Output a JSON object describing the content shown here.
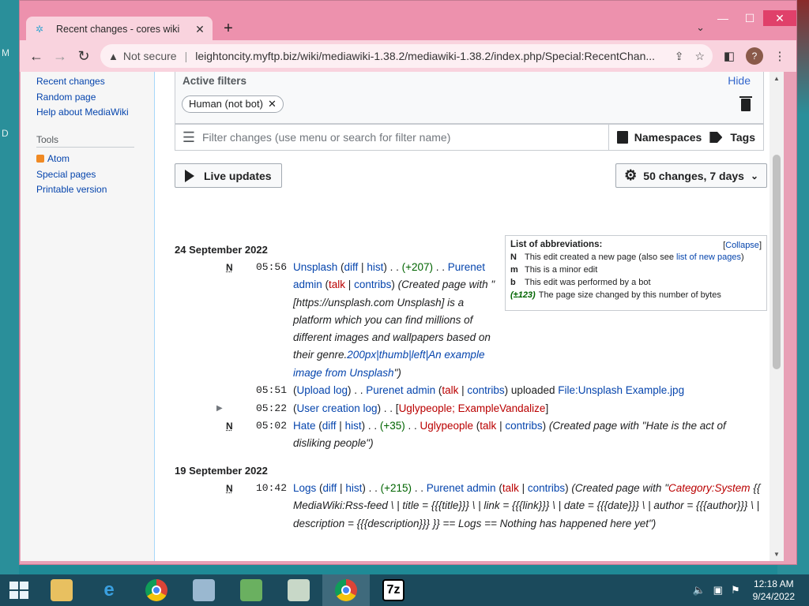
{
  "desktop": {
    "left_labels": [
      "M",
      "D"
    ]
  },
  "browser": {
    "tab_title": "Recent changes - cores wiki",
    "not_secure": "Not secure",
    "url_separator": "|",
    "url": "leightoncity.myftp.biz/wiki/mediawiki-1.38.2/mediawiki-1.38.2/index.php/Special:RecentChan...",
    "profile_initial": "?"
  },
  "sidebar": {
    "nav": [
      "Recent changes",
      "Random page",
      "Help about MediaWiki"
    ],
    "tools_heading": "Tools",
    "tools": [
      "Atom",
      "Special pages",
      "Printable version"
    ]
  },
  "filters": {
    "active_label": "Active filters",
    "hide_label": "Hide",
    "chip": "Human (not bot)",
    "search_placeholder": "Filter changes (use menu or search for filter name)",
    "namespaces": "Namespaces",
    "tags": "Tags",
    "live_updates": "Live updates",
    "limits": "50 changes, 7 days"
  },
  "legend": {
    "heading": "List of abbreviations:",
    "collapse": "Collapse",
    "rows": [
      {
        "key": "N",
        "text": "This edit created a new page (also see ",
        "link": "list of new pages",
        "after": ")"
      },
      {
        "key": "m",
        "text": "This is a minor edit"
      },
      {
        "key": "b",
        "text": "This edit was performed by a bot"
      },
      {
        "key": "(±123)",
        "text": "The page size changed by this number of bytes"
      }
    ]
  },
  "days": [
    {
      "date": "24 September 2022",
      "entries": [
        {
          "flag": "N",
          "time": "05:56",
          "page": "Unsplash",
          "diff": "diff",
          "hist": "hist",
          "size": "(+207)",
          "user": "Purenet admin",
          "talk": "talk",
          "contribs": "contribs",
          "summary_lines": [
            "(Created page",
            "with \"[https://unsplash.com Unsplash] is",
            "a platform which you can find millions of",
            "different images and wallpapers based",
            "on their genre."
          ],
          "summary_link": "200px|thumb|left|An",
          "summary_link2": "example image from Unsplash",
          "summary_end": "\")"
        },
        {
          "time": "05:51",
          "log": "Upload log",
          "user": "Purenet admin",
          "talk": "talk",
          "contribs": "contribs",
          "action": "uploaded",
          "file": "File:Unsplash Example.jpg"
        },
        {
          "time": "05:22",
          "log": "User creation log",
          "users": "Uglypeople; ExampleVandalize"
        },
        {
          "flag": "N",
          "time": "05:02",
          "page": "Hate",
          "diff": "diff",
          "hist": "hist",
          "size": "(+35)",
          "user": "Uglypeople",
          "talk": "talk",
          "contribs": "contribs",
          "summary": "(Created page with \"Hate is the act of",
          "summary2": "disliking people\")"
        }
      ]
    },
    {
      "date": "19 September 2022",
      "entries": [
        {
          "flag": "N",
          "time": "10:42",
          "page": "Logs",
          "diff": "diff",
          "hist": "hist",
          "size": "(+215)",
          "user": "Purenet admin",
          "talk": "talk",
          "contribs": "contribs",
          "summary": "(Created page with",
          "summary_cat": "Category:System",
          "summary_rest": " {{ MediaWiki:Rss-feed \\ | title = {{{title}}} \\ | link = {{{link}}} \\ | date = {{{date}}} \\",
          "summary_line3": "| author = {{{author}}} \\ | description = {{{description}}} }} == Logs == Nothing has happened here",
          "summary_line4": "yet\")"
        }
      ]
    }
  ],
  "taskbar": {
    "time": "12:18 AM",
    "date": "9/24/2022",
    "sevenzip": "7z"
  }
}
